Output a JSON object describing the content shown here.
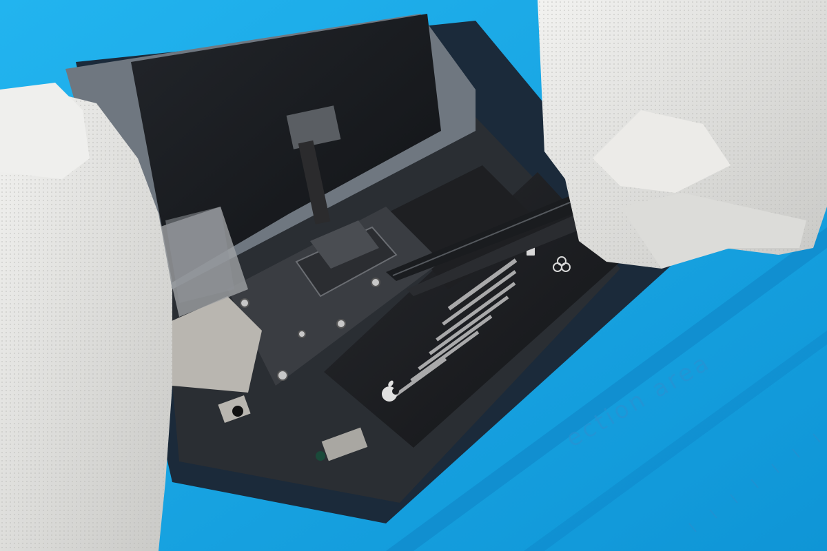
{
  "scene": {
    "description_label": "",
    "mat_text": "ection area",
    "palette": {
      "mat": "#17a6e6",
      "mat_shadow": "#0f7fbf",
      "phone_frame": "#1b2a3a",
      "chassis": "#2a2e33",
      "battery": "#1c1d20",
      "display_back": "#15171a",
      "glove": "#e4e4e2",
      "glove_shadow": "#bdbdbb",
      "tweezers": "#1a1c1f",
      "metal": "#b9b6b0"
    },
    "icons": [
      "apple-logo-icon",
      "recycle-icon",
      "trash-bin-icon"
    ]
  }
}
